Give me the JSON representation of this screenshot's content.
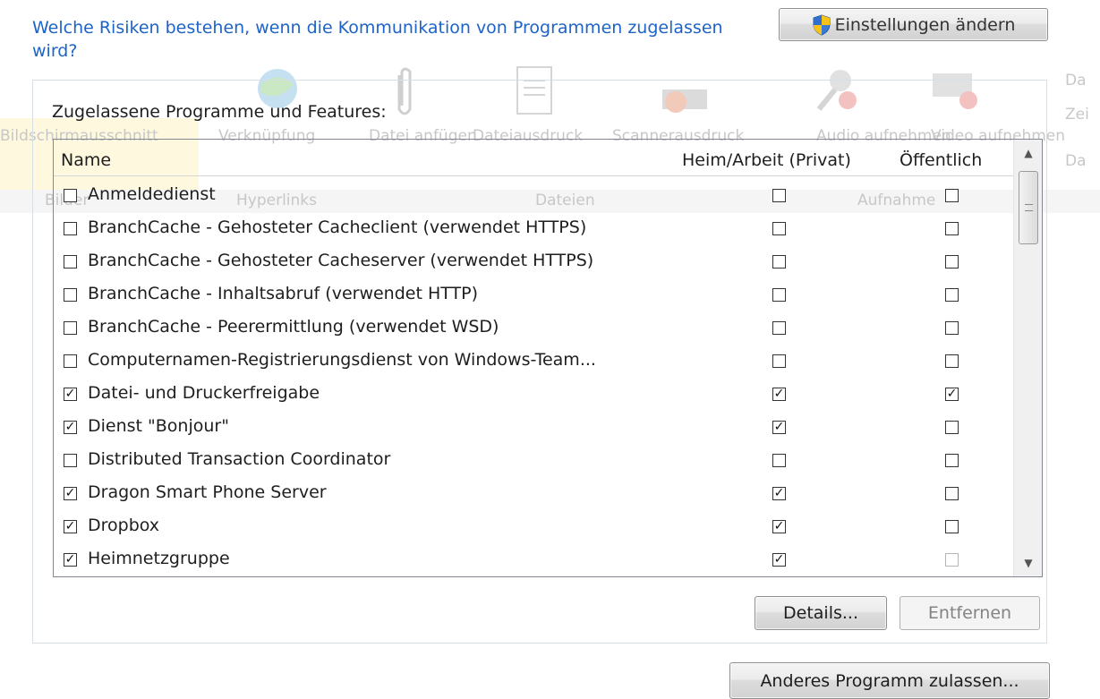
{
  "header": {
    "risk_link": "Welche Risiken bestehen, wenn die Kommunikation von Programmen zugelassen wird?",
    "settings_button": "Einstellungen ändern"
  },
  "background_ribbon": {
    "items": [
      "Bildschirmausschnitt",
      "Verknüpfung",
      "Datei anfügen",
      "Dateiausdruck",
      "Scannerausdruck",
      "Audio aufnehmen",
      "Video aufnehmen"
    ],
    "groups": [
      "Bilder",
      "Hyperlinks",
      "Dateien",
      "Aufnahme"
    ],
    "side_items": [
      "Da",
      "Zei",
      "Da"
    ]
  },
  "group": {
    "title": "Zugelassene Programme und Features:",
    "columns": {
      "name": "Name",
      "private": "Heim/Arbeit (Privat)",
      "public": "Öffentlich"
    },
    "rows": [
      {
        "name": "Anmeldedienst",
        "enabled": false,
        "private": false,
        "public": false
      },
      {
        "name": "BranchCache - Gehosteter Cacheclient (verwendet HTTPS)",
        "enabled": false,
        "private": false,
        "public": false
      },
      {
        "name": "BranchCache - Gehosteter Cacheserver (verwendet HTTPS)",
        "enabled": false,
        "private": false,
        "public": false
      },
      {
        "name": "BranchCache - Inhaltsabruf (verwendet HTTP)",
        "enabled": false,
        "private": false,
        "public": false
      },
      {
        "name": "BranchCache - Peerermittlung (verwendet WSD)",
        "enabled": false,
        "private": false,
        "public": false
      },
      {
        "name": "Computernamen-Registrierungsdienst von Windows-Team...",
        "enabled": false,
        "private": false,
        "public": false
      },
      {
        "name": "Datei- und Druckerfreigabe",
        "enabled": true,
        "private": true,
        "public": true
      },
      {
        "name": "Dienst \"Bonjour\"",
        "enabled": true,
        "private": true,
        "public": false
      },
      {
        "name": "Distributed Transaction Coordinator",
        "enabled": false,
        "private": false,
        "public": false
      },
      {
        "name": "Dragon Smart Phone Server",
        "enabled": true,
        "private": true,
        "public": false
      },
      {
        "name": "Dropbox",
        "enabled": true,
        "private": true,
        "public": false
      },
      {
        "name": "Heimnetzgruppe",
        "enabled": true,
        "private": true,
        "public": false
      }
    ],
    "details_button": "Details...",
    "remove_button": "Entfernen"
  },
  "footer": {
    "allow_button": "Anderes Programm zulassen..."
  }
}
